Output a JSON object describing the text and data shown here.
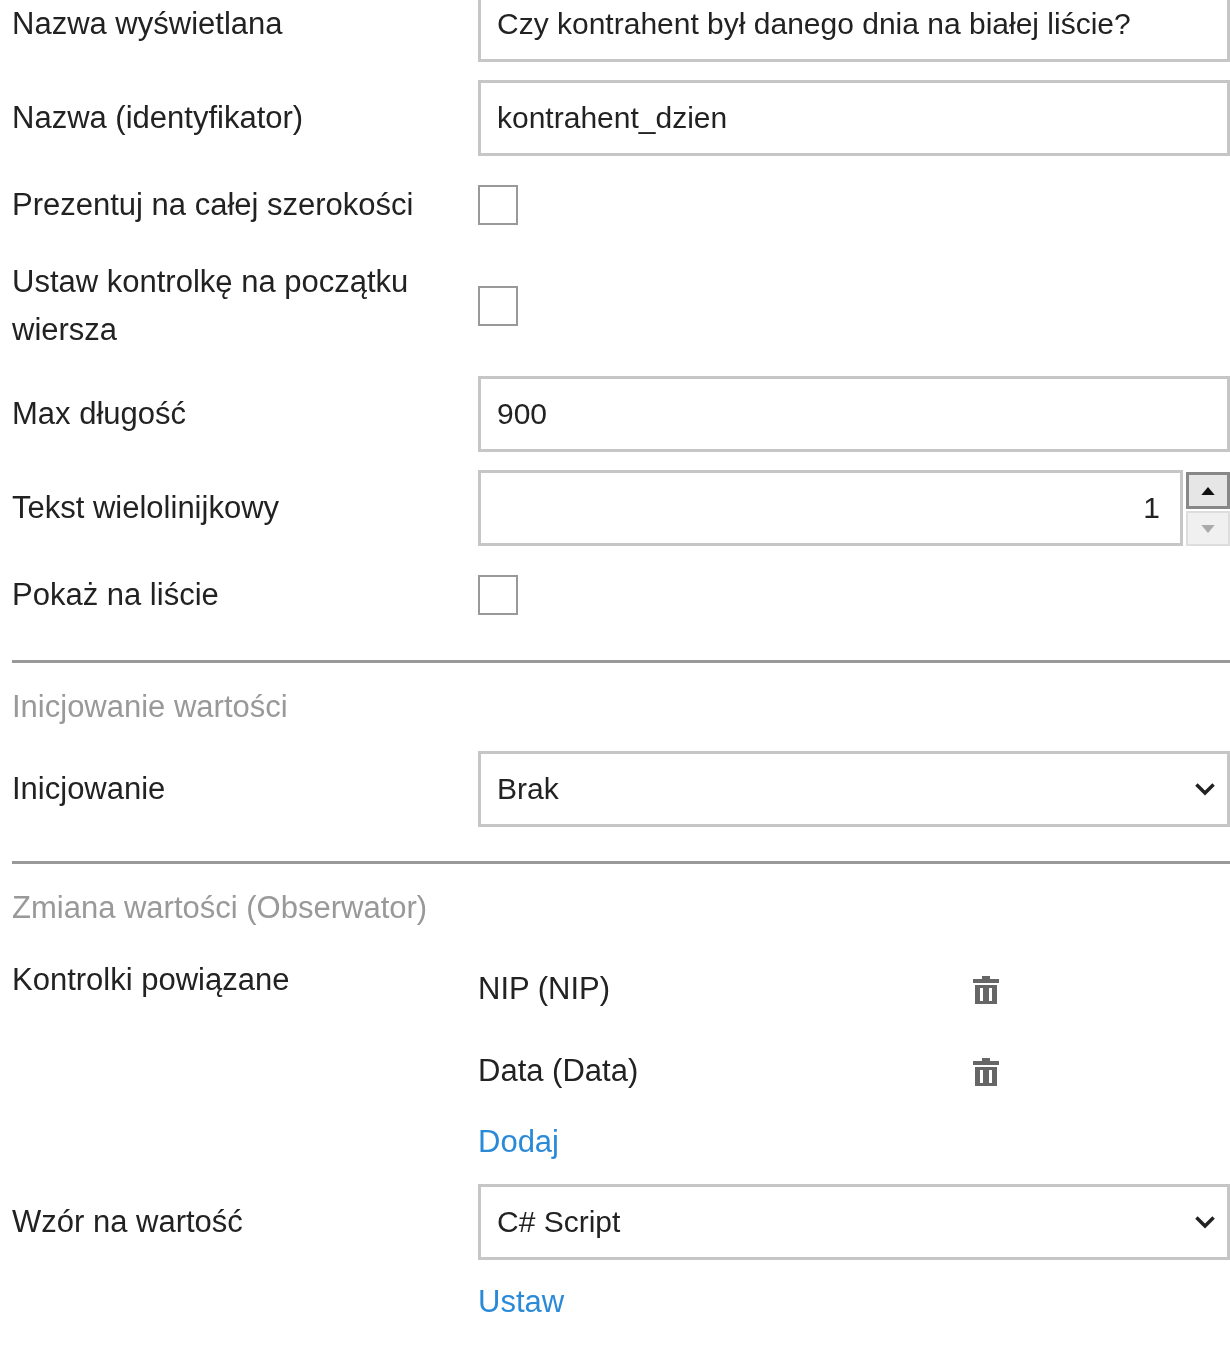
{
  "rows": [
    {
      "kind": "text",
      "label": "Nazwa wyświetlana",
      "value": "Czy kontrahent był danego dnia na białej liście?"
    },
    {
      "kind": "text",
      "label": "Nazwa (identyfikator)",
      "value": "kontrahent_dzien"
    },
    {
      "kind": "checkbox",
      "label": "Prezentuj na całej szerokości",
      "checked": false
    },
    {
      "kind": "checkbox",
      "label": "Ustaw kontrolkę na początku wiersza",
      "checked": false
    },
    {
      "kind": "text",
      "label": "Max długość",
      "value": "900"
    },
    {
      "kind": "spinner",
      "label": "Tekst wielolinijkowy",
      "value": "1",
      "down_disabled": true
    },
    {
      "kind": "checkbox",
      "label": "Pokaż na liście",
      "checked": false
    },
    {
      "kind": "section",
      "label": "Inicjowanie wartości"
    },
    {
      "kind": "select",
      "label": "Inicjowanie",
      "value": "Brak"
    },
    {
      "kind": "section",
      "label": "Zmiana wartości (Obserwator)"
    },
    {
      "kind": "linked",
      "label": "Kontrolki powiązane",
      "items": [
        "NIP (NIP)",
        "Data (Data)"
      ],
      "link": "Dodaj"
    },
    {
      "kind": "select",
      "label": "Wzór na wartość",
      "value": "C# Script",
      "link": "Ustaw"
    }
  ]
}
